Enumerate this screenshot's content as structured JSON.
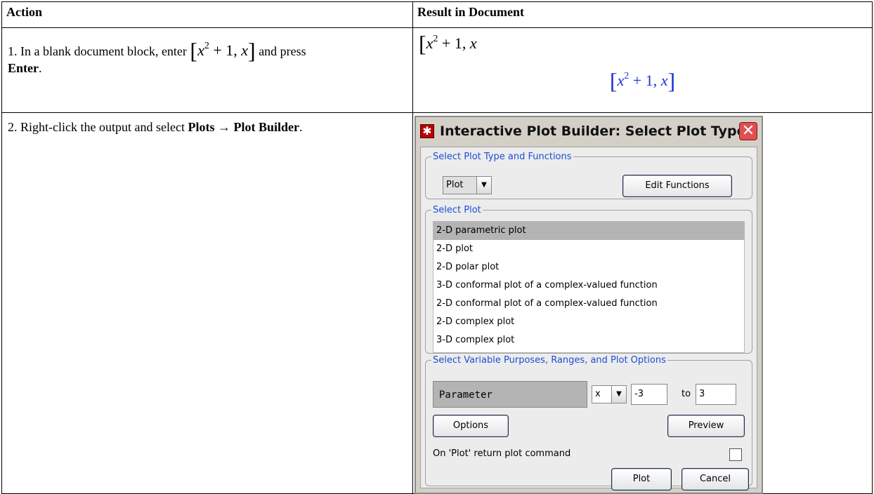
{
  "table": {
    "headers": [
      "Action",
      "Result in Document"
    ],
    "step1": {
      "action_prefix": "1. In a blank document block, enter",
      "math_base": "x",
      "math_exp": "2",
      "math_rest": " + 1, ",
      "math_var": "x",
      "action_suffix": " and press",
      "enter_label": "Enter",
      "period": "."
    },
    "step2": {
      "action_prefix": "2. Right-click the output and select",
      "menu_path": "Plots → Plot Builder",
      "period": "."
    }
  },
  "dialog": {
    "title": "Interactive Plot Builder: Select Plot Type",
    "group_type_label": "Select Plot Type and Functions",
    "plot_type_value": "Plot",
    "edit_functions_label": "Edit Functions",
    "group_select_label": "Select Plot",
    "plot_items": [
      "2-D parametric plot",
      "2-D plot",
      "2-D polar plot",
      "3-D conformal plot of a complex-valued function",
      "2-D conformal plot of a complex-valued function",
      "2-D complex plot",
      "3-D complex plot"
    ],
    "selected_index": 0,
    "group_vars_label": "Select Variable Purposes, Ranges, and Plot Options",
    "param_label": "Parameter",
    "var_value": "x",
    "range_from": "-3",
    "to_label": "to",
    "range_to": "3",
    "options_label": "Options",
    "preview_label": "Preview",
    "return_cmd_label": "On 'Plot' return plot command",
    "return_cmd_checked": false,
    "plot_label": "Plot",
    "cancel_label": "Cancel"
  },
  "colors": {
    "output_blue": "#1a2fd6",
    "legend_blue": "#1b4fd4"
  }
}
